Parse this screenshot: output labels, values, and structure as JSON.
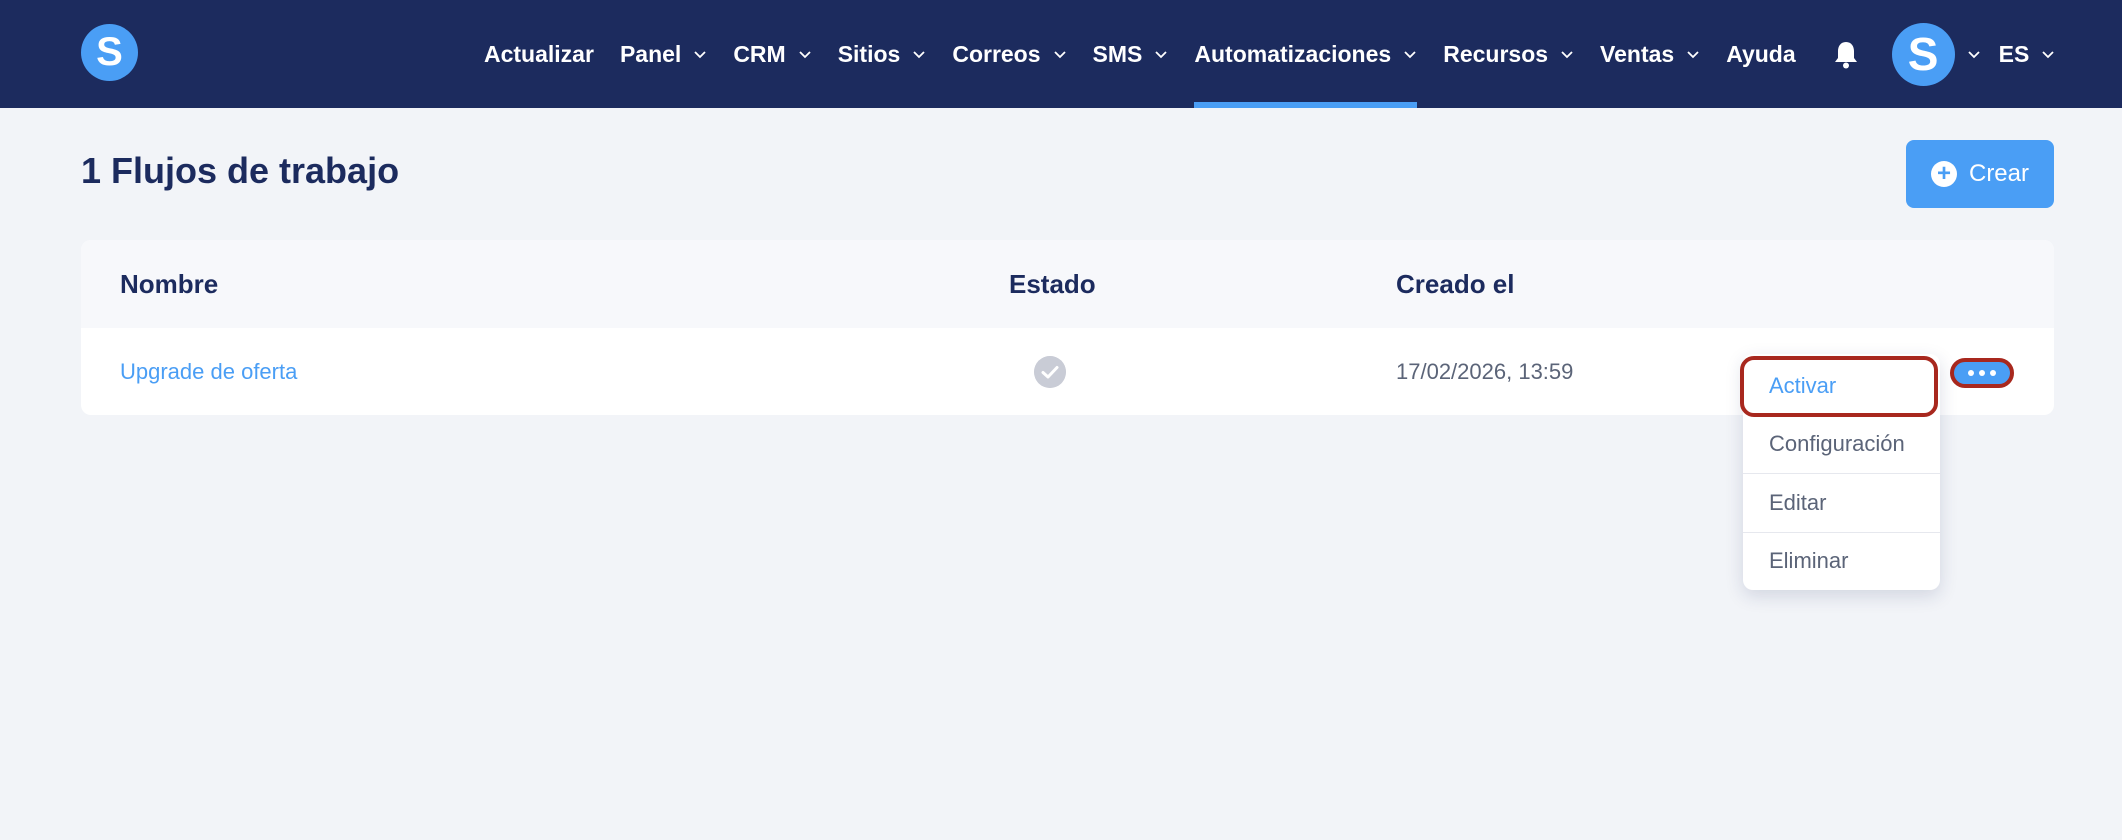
{
  "app": {
    "logo_letter": "S",
    "brand_color": "#4a9ef5",
    "nav_bg_color": "#1c2b5e",
    "highlight_color": "#a8281e"
  },
  "nav": {
    "items": [
      {
        "label": "Actualizar",
        "has_dropdown": false,
        "active": false
      },
      {
        "label": "Panel",
        "has_dropdown": true,
        "active": false
      },
      {
        "label": "CRM",
        "has_dropdown": true,
        "active": false
      },
      {
        "label": "Sitios",
        "has_dropdown": true,
        "active": false
      },
      {
        "label": "Correos",
        "has_dropdown": true,
        "active": false
      },
      {
        "label": "SMS",
        "has_dropdown": true,
        "active": false
      },
      {
        "label": "Automatizaciones",
        "has_dropdown": true,
        "active": true
      },
      {
        "label": "Recursos",
        "has_dropdown": true,
        "active": false
      },
      {
        "label": "Ventas",
        "has_dropdown": true,
        "active": false
      },
      {
        "label": "Ayuda",
        "has_dropdown": false,
        "active": false
      }
    ],
    "notification_icon": "bell-icon",
    "avatar_letter": "S",
    "language": "ES"
  },
  "page": {
    "title": "1 Flujos de trabajo",
    "create_label": "Crear"
  },
  "table": {
    "columns": [
      "Nombre",
      "Estado",
      "Creado el"
    ],
    "rows": [
      {
        "name": "Upgrade de oferta",
        "status_icon": "check-circle-icon",
        "created": "17/02/2026, 13:59"
      }
    ]
  },
  "menu": {
    "items": [
      "Activar",
      "Configuración",
      "Editar",
      "Eliminar"
    ]
  }
}
